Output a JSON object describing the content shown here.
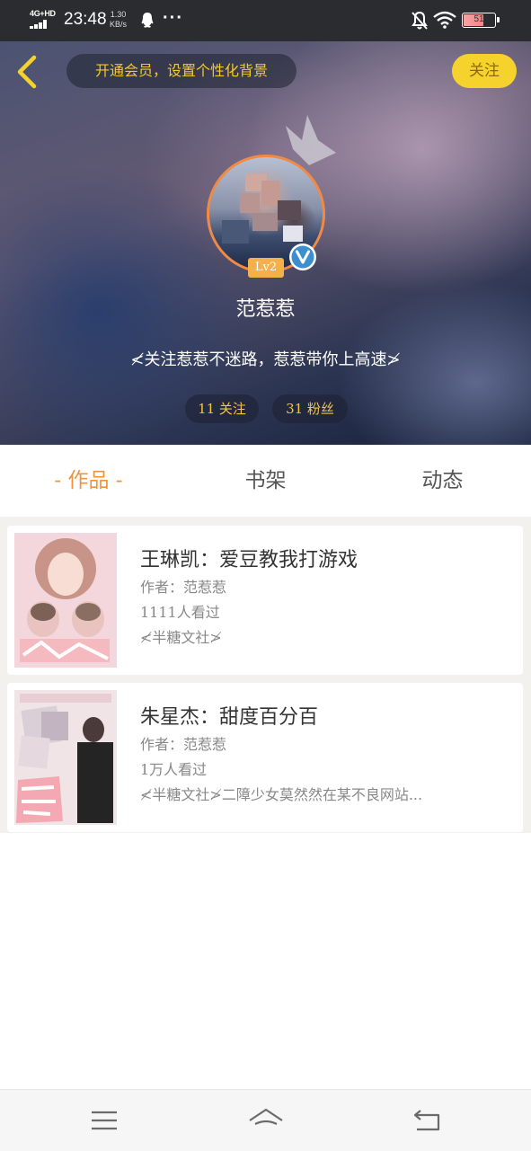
{
  "status_bar": {
    "network": "4G+HD",
    "time": "23:48",
    "speed_value": "1.30",
    "speed_unit": "KB/s",
    "more": "···",
    "battery": "51",
    "icons": [
      "signal-icon",
      "qq-icon",
      "mute-bell-icon",
      "wifi-icon",
      "battery-icon"
    ]
  },
  "header": {
    "back_icon": "back-chevron-icon",
    "vip_banner": "开通会员，设置个性化背景",
    "follow_button": "关注",
    "level_badge": "Lv2",
    "verified_icon": "verified-v-icon",
    "crown_icon": "crown-icon",
    "username": "范惹惹",
    "signature": "≮关注惹惹不迷路，惹惹带你上高速≯",
    "following": "11 关注",
    "fans": "31 粉丝"
  },
  "tabs": [
    {
      "label": "- 作品 -",
      "active": true
    },
    {
      "label": "书架",
      "active": false
    },
    {
      "label": "动态",
      "active": false
    }
  ],
  "works": [
    {
      "title": "王琳凯：爱豆教我打游戏",
      "author": "作者：范惹惹",
      "views": "1111人看过",
      "description": "≮半糖文社≯"
    },
    {
      "title": "朱星杰：甜度百分百",
      "author": "作者：范惹惹",
      "views": "1万人看过",
      "description": "≮半糖文社≯二障少女莫然然在某不良网站..."
    }
  ],
  "nav": {
    "icons": [
      "menu-icon",
      "home-icon",
      "back-icon"
    ]
  },
  "colors": {
    "accent_orange": "#ee9440",
    "follow_yellow": "#f6d22c",
    "gold_text": "#f4c641",
    "verified_blue": "#3b8fd0"
  }
}
